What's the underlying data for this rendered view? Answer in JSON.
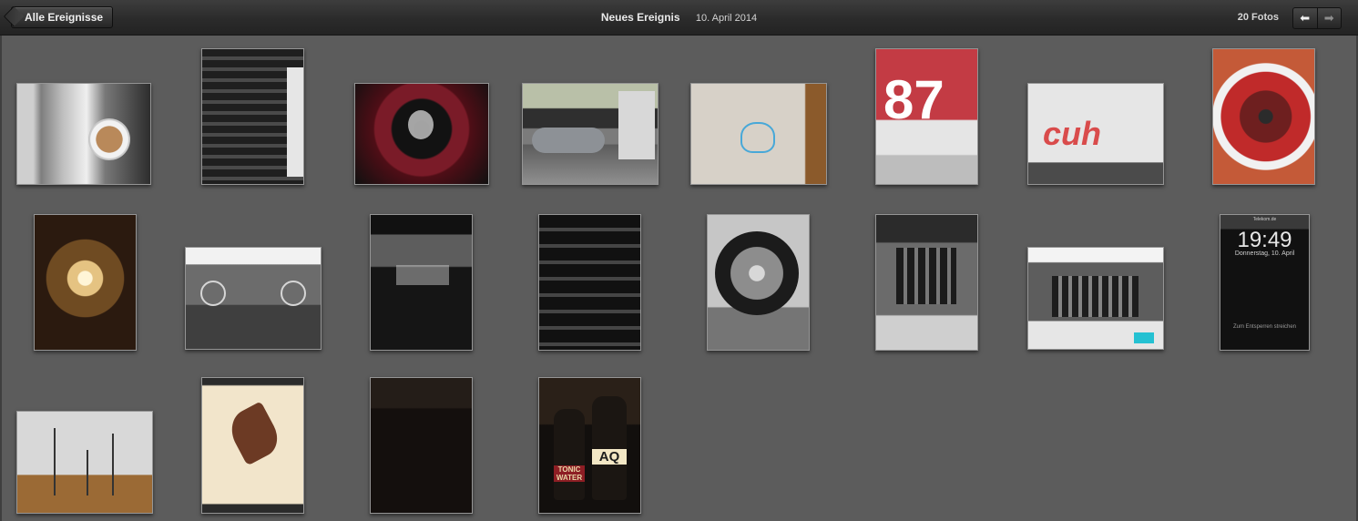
{
  "toolbar": {
    "back_label": "Alle Ereignisse",
    "event_name": "Neues Ereignis",
    "event_date": "10. April 2014",
    "photo_count": "20 Fotos",
    "nav_prev_icon": "left-arrow-icon",
    "nav_next_icon": "right-arrow-icon"
  },
  "photos": {
    "lock_screen": {
      "status": "Telekom.de",
      "time": "19:49",
      "date": "Donnerstag, 10. April",
      "hint": "Zum Entsperren streichen"
    },
    "tonic_label": "TONIC WATER",
    "aq_label": "AQ"
  },
  "colors": {
    "toolbar_top": "#3d3d3d",
    "toolbar_bottom": "#232323",
    "content_bg": "#5c5c5c"
  }
}
